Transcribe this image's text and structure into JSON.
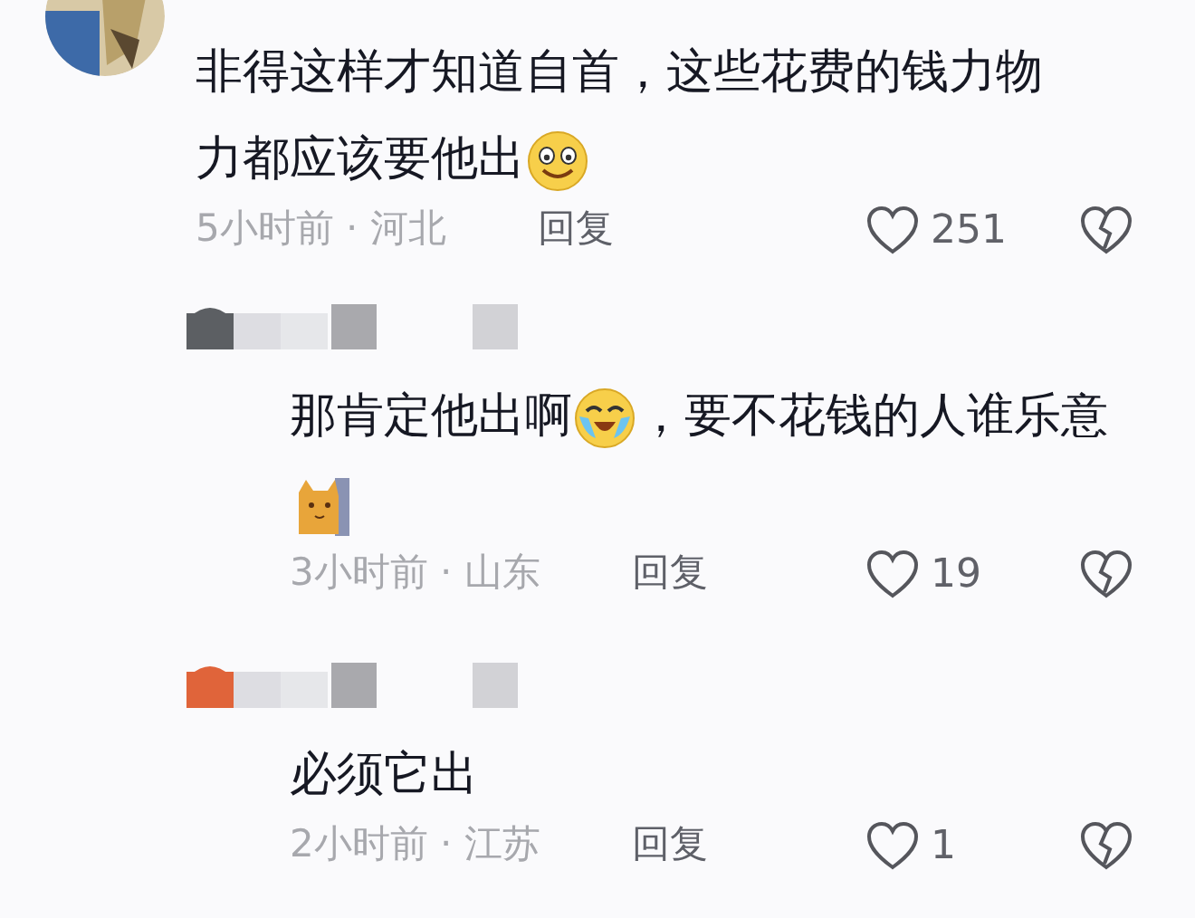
{
  "comments": [
    {
      "text": [
        {
          "kind": "text",
          "text": "非得这样才知道自首，这些花费的钱力物力都应该要他出"
        },
        {
          "kind": "smile"
        }
      ],
      "meta": "5小时前 · 河北",
      "reply": "回复",
      "likes": "251",
      "children": [
        {
          "text": [
            {
              "kind": "text",
              "text": "那肯定他出啊"
            },
            {
              "kind": "tears"
            },
            {
              "kind": "text",
              "text": "，要不花钱的人谁乐意"
            },
            {
              "kind": "cat"
            }
          ],
          "meta": "3小时前 · 山东",
          "reply": "回复",
          "likes": "19",
          "color": "#5c5f63"
        },
        {
          "text": [
            {
              "kind": "text",
              "text": "必须它出"
            }
          ],
          "meta": "2小时前 · 江苏",
          "reply": "回复",
          "likes": "1",
          "color": "#e0643a"
        }
      ]
    }
  ]
}
